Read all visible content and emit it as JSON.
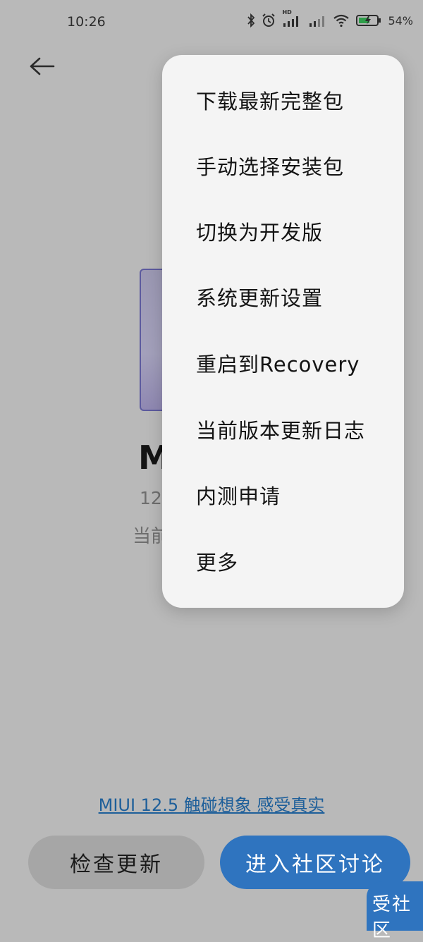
{
  "status_bar": {
    "time": "10:26",
    "hd_label": "HD",
    "battery_percent": "54%"
  },
  "page": {
    "version_title": "M",
    "version_number": "12.",
    "current_label": "当前"
  },
  "menu": {
    "items": [
      {
        "label": "下载最新完整包"
      },
      {
        "label": "手动选择安装包"
      },
      {
        "label": "切换为开发版"
      },
      {
        "label": "系统更新设置"
      },
      {
        "label": "重启到Recovery"
      },
      {
        "label": "当前版本更新日志"
      },
      {
        "label": "内测申请"
      },
      {
        "label": "更多"
      }
    ]
  },
  "promo_link": "MIUI 12.5 触碰想象 感受真实",
  "buttons": {
    "check_update": "检查更新",
    "community": "进入社区讨论",
    "community_bubble": "受社区"
  },
  "colors": {
    "accent_blue": "#2f74bf",
    "link_blue": "#1e5f9a",
    "menu_bg": "#f4f4f4",
    "dim_bg": "#b9b9b9"
  }
}
